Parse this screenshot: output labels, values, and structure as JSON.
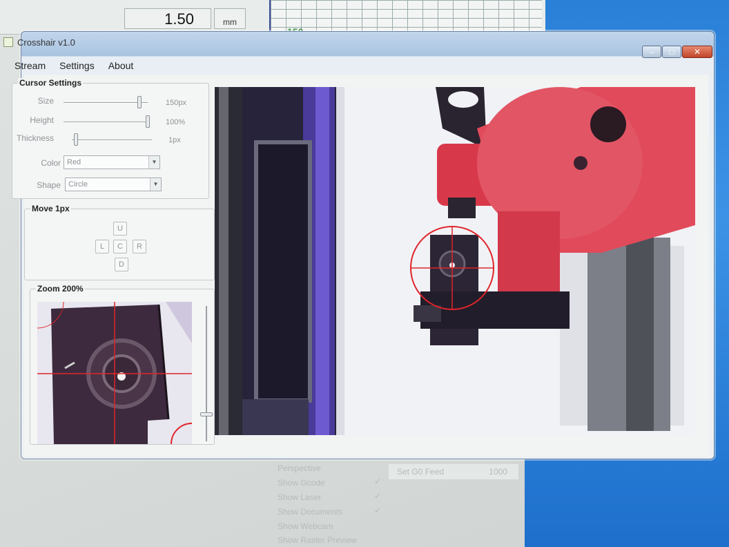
{
  "background": {
    "measure_value": "1.50",
    "measure_unit": "mm",
    "grid_label": "150",
    "menu_items": [
      {
        "label": "Perspective",
        "checked": false
      },
      {
        "label": "Show Gcode",
        "checked": true
      },
      {
        "label": "Show Laser",
        "checked": true
      },
      {
        "label": "Show Documents",
        "checked": true
      },
      {
        "label": "Show Webcam",
        "checked": false
      },
      {
        "label": "Show Raster Preview",
        "checked": false
      }
    ],
    "feed_label": "Set G0 Feed",
    "feed_value": "1000"
  },
  "window": {
    "title": "Crosshair v1.0",
    "menu": [
      "Stream",
      "Settings",
      "About"
    ]
  },
  "cursor_settings": {
    "legend": "Cursor Settings",
    "size": {
      "label": "Size",
      "value": "150px",
      "level": 0.9
    },
    "height": {
      "label": "Height",
      "value": "100%",
      "level": 1.0
    },
    "thickness": {
      "label": "Thickness",
      "value": "1px",
      "level": 0.05
    },
    "color": {
      "label": "Color",
      "value": "Red"
    },
    "shape": {
      "label": "Shape",
      "value": "Circle"
    }
  },
  "move": {
    "legend": "Move 1px",
    "up": "U",
    "left": "L",
    "center": "C",
    "right": "R",
    "down": "D"
  },
  "zoom": {
    "legend": "Zoom 200%",
    "level": 0.2
  },
  "colors": {
    "crosshair": "#e0242a",
    "title_bar": "#a9c3e0",
    "close_button": "#c0442a"
  }
}
